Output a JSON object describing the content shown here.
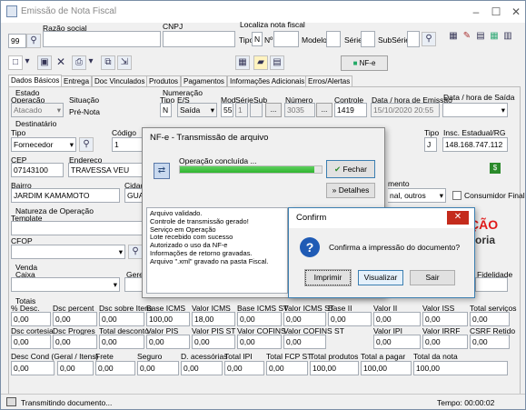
{
  "window": {
    "title": "Emissão de Nota Fiscal"
  },
  "top": {
    "razao_label": "Razão social",
    "cnpj_label": "CNPJ",
    "localiza_label": "Localiza nota fiscal",
    "company_code": "99",
    "tipo_label": "Tipo",
    "n_label": "N",
    "no_label": "Nº",
    "modelo_label": "Modelo",
    "serie_label": "Série",
    "subserie_label": "SubSérie"
  },
  "toolbar": {
    "nfe_label": "NF-e"
  },
  "tabs": [
    "Dados Básicos",
    "Entrega",
    "Doc Vinculados",
    "Produtos",
    "Pagamentos",
    "Informações Adicionais",
    "Erros/Alertas"
  ],
  "estado": {
    "section": "Estado",
    "operacao_label": "Operação",
    "operacao_value": "Atacado",
    "situacao_label": "Situação",
    "situacao_value": "Pré-Nota"
  },
  "numeracao": {
    "section": "Numeração",
    "tipo_label": "Tipo",
    "tipo_value": "N",
    "es_label": "E/S",
    "es_value": "Saída",
    "mod_label": "Mod",
    "mod_value": "55",
    "serie_label": "Série",
    "serie_value": "1",
    "sub_label": "Sub",
    "numero_label": "Número",
    "numero_value": "3035",
    "controle_label": "Controle",
    "controle_value": "1419",
    "data_emissao_label": "Data / hora de Emissão",
    "data_emissao_value": "15/10/2020 20:55",
    "data_saida_label": "Data / hora de Saída"
  },
  "destinatario": {
    "section": "Destinatário",
    "tipo_label": "Tipo",
    "tipo_value": "Fornecedor",
    "codigo_label": "Código",
    "codigo_value": "1",
    "tipo2_label": "Tipo",
    "tipo2_value": "J",
    "ie_label": "Insc. Estadual/RG",
    "ie_value": "148.168.747.112",
    "cep_label": "CEP",
    "cep_value": "07143100",
    "endereco_label": "Endereço",
    "endereco_value": "TRAVESSA VEU",
    "bairro_label": "Bairro",
    "bairro_value": "JARDIM KAMAMOTO",
    "cidade_label": "Cidad",
    "cidade_value": "GUA",
    "consumo_label": "mento",
    "consumo_value": "nal, outros",
    "consumidor_final_label": "Consumidor Final"
  },
  "natureza": {
    "section": "Natureza de Operação",
    "template_label": "Template",
    "cfop_label": "CFOP"
  },
  "venda": {
    "section": "Venda",
    "caixa_label": "Caixa",
    "gere_label": "Gere",
    "fidelidade_label": "Fidelidade"
  },
  "totais": {
    "section": "Totais",
    "row1": [
      {
        "label": "% Desc.",
        "value": "0,00"
      },
      {
        "label": "Dsc percent",
        "value": "0,00"
      },
      {
        "label": "Dsc sobre Itens",
        "value": "0,00"
      },
      {
        "label": "Base ICMS",
        "value": "100,00"
      },
      {
        "label": "Valor ICMS",
        "value": "18,00"
      },
      {
        "label": "Base ICMS ST",
        "value": "0,00"
      },
      {
        "label": "Valor ICMS ST",
        "value": "0,00"
      },
      {
        "label": "Base II",
        "value": "0,00"
      },
      {
        "label": "Valor II",
        "value": "0,00"
      },
      {
        "label": "Valor ISS",
        "value": "0,00"
      },
      {
        "label": "Total serviços",
        "value": "0,00"
      }
    ],
    "row2": [
      {
        "label": "Dsc cortesia",
        "value": "0,00"
      },
      {
        "label": "Dsc Progres",
        "value": "0,00"
      },
      {
        "label": "Total desconto",
        "value": "0,00"
      },
      {
        "label": "Valor PIS",
        "value": "0,00"
      },
      {
        "label": "Valor PIS ST",
        "value": "0,00"
      },
      {
        "label": "Valor COFINS",
        "value": "0,00"
      },
      {
        "label": "Valor COFINS ST",
        "value": "0,00"
      },
      {
        "label": "",
        "value": ""
      },
      {
        "label": "Valor IPI",
        "value": "0,00"
      },
      {
        "label": "Valor IRRF",
        "value": "0,00"
      },
      {
        "label": "CSRF Retido",
        "value": "0,00"
      }
    ],
    "row3": [
      {
        "label": "Desc Cond (Geral / Itens)",
        "value": "0,00"
      },
      {
        "label": "",
        "value": "0,00"
      },
      {
        "label": "Frete",
        "value": "0,00"
      },
      {
        "label": "Seguro",
        "value": "0,00"
      },
      {
        "label": "D. acessórias",
        "value": "0,00"
      },
      {
        "label": "Total IPI",
        "value": "0,00"
      },
      {
        "label": "Total FCP ST",
        "value": "0,00"
      },
      {
        "label": "Total produtos",
        "value": "100,00"
      },
      {
        "label": "Total a pagar",
        "value": "100,00"
      },
      {
        "label": "Total da nota",
        "value": "100,00"
      }
    ]
  },
  "status": {
    "message": "Transmitindo documento...",
    "time": "Tempo: 00:00:02"
  },
  "nfe_dialog": {
    "title": "NF-e - Transmissão de arquivo",
    "progress_text": "Operação concluída ...",
    "progress": 0.95,
    "fechar_label": "Fechar",
    "detalhes_label": "Detalhes",
    "log": [
      "Arquivo validado.",
      "Controle de transmissão gerado!",
      "Serviço em Operação",
      "Lote recebido com sucesso",
      "Autorizado o uso da NF-e",
      "Informações de retorno gravadas.",
      "Arquivo \".xml\" gravado na pasta Fiscal."
    ]
  },
  "confirm_dialog": {
    "title": "Confirm",
    "message": "Confirma a impressão do documento?",
    "imprimir": "Imprimir",
    "visualizar": "Visualizar",
    "sair": "Sair",
    "close": "✕"
  },
  "banner": {
    "line1": "ÇÃO",
    "line2": "oria"
  },
  "colors": {
    "progress": "#2fb52f",
    "banner_red": "#e01a1a",
    "close_red": "#c42b1c"
  }
}
